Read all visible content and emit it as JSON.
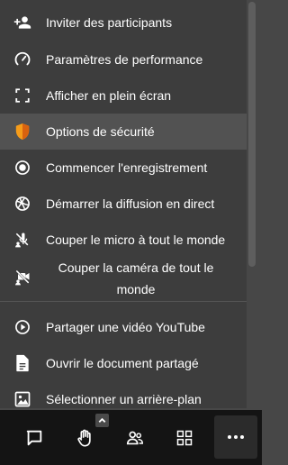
{
  "menu": {
    "items": [
      {
        "label": "Inviter des participants",
        "icon": "add-person-icon"
      },
      {
        "label": "Paramètres de performance",
        "icon": "gauge-icon"
      },
      {
        "label": "Afficher en plein écran",
        "icon": "fullscreen-icon"
      },
      {
        "label": "Options de sécurité",
        "icon": "shield-icon",
        "active": true
      },
      {
        "label": "Commencer l'enregistrement",
        "icon": "record-icon"
      },
      {
        "label": "Démarrer la diffusion en direct",
        "icon": "livestream-icon"
      },
      {
        "label": "Couper le micro à tout le monde",
        "icon": "mute-mic-icon"
      },
      {
        "label": "Couper la caméra de tout le monde",
        "icon": "camera-off-icon"
      },
      {
        "label": "Partager une vidéo YouTube",
        "icon": "play-circle-icon"
      },
      {
        "label": "Ouvrir le document partagé",
        "icon": "document-icon"
      },
      {
        "label": "Sélectionner un arrière-plan",
        "icon": "background-image-icon"
      }
    ]
  },
  "toolbar": {
    "buttons": [
      {
        "name": "chat",
        "icon": "chat-icon"
      },
      {
        "name": "raise-hand",
        "icon": "hand-icon"
      },
      {
        "name": "participants",
        "icon": "participants-icon"
      },
      {
        "name": "tile-view",
        "icon": "grid-icon"
      },
      {
        "name": "more",
        "icon": "more-dots-icon"
      }
    ]
  },
  "colors": {
    "menu_bg": "#3d3d3d",
    "active_bg": "#525252",
    "toolbar_bg": "#141414",
    "shield_orange": "#f59c1a"
  }
}
